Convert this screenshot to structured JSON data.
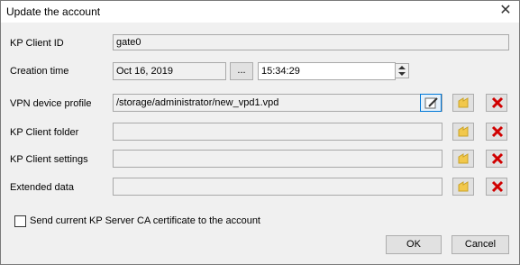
{
  "window": {
    "title": "Update the account"
  },
  "fields": {
    "client_id": {
      "label": "KP Client ID",
      "value": "gate0"
    },
    "creation_time": {
      "label": "Creation time",
      "date": "Oct 16, 2019",
      "browse": "...",
      "time": "15:34:29"
    },
    "vpn_profile": {
      "label": "VPN device profile",
      "value": "/storage/administrator/new_vpd1.vpd"
    },
    "client_folder": {
      "label": "KP Client folder",
      "value": ""
    },
    "client_settings": {
      "label": "KP Client settings",
      "value": ""
    },
    "extended_data": {
      "label": "Extended data",
      "value": ""
    }
  },
  "checkbox": {
    "label": "Send current KP Server CA certificate to the account",
    "checked": false
  },
  "buttons": {
    "ok": "OK",
    "cancel": "Cancel"
  },
  "icons": {
    "edit": "edit-icon",
    "folder": "folder-icon",
    "delete": "delete-icon"
  },
  "colors": {
    "delete_red": "#d00000",
    "folder_yellow": "#f2c84b",
    "active_blue": "#0078d7"
  }
}
